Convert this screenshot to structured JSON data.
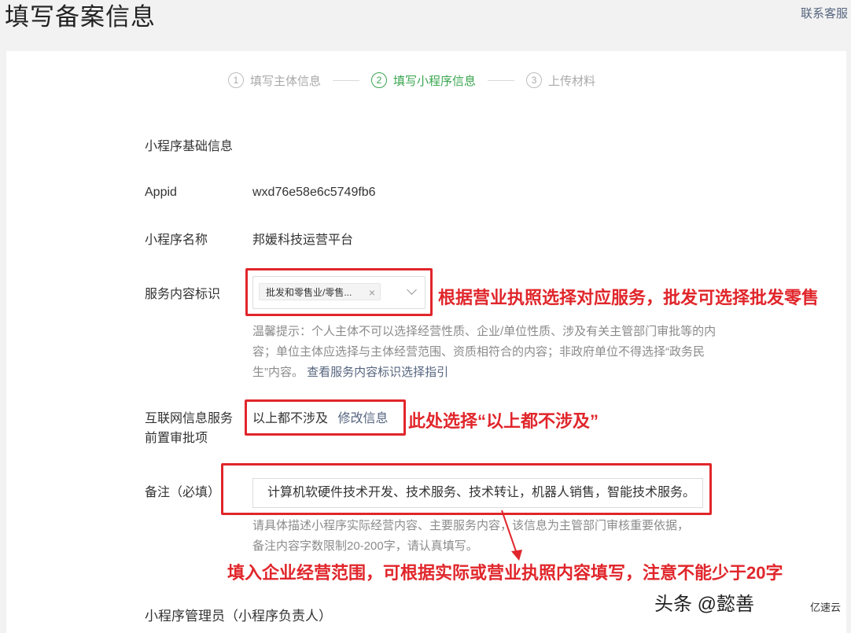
{
  "header": {
    "title": "填写备案信息",
    "service_link": "联系客服"
  },
  "steps": [
    {
      "num": "1",
      "label": "填写主体信息",
      "active": false
    },
    {
      "num": "2",
      "label": "填写小程序信息",
      "active": true
    },
    {
      "num": "3",
      "label": "上传材料",
      "active": false
    }
  ],
  "form": {
    "section_title": "小程序基础信息",
    "appid_label": "Appid",
    "appid_value": "wxd76e58e6c5749fb6",
    "name_label": "小程序名称",
    "name_value": "邦媛科技运营平台",
    "service_label": "服务内容标识",
    "service_tag": "批发和零售业/零售...",
    "service_tag_close": "×",
    "service_tip": "温馨提示：个人主体不可以选择经营性质、企业/单位性质、涉及有关主管部门审批等的内容；单位主体应选择与主体经营范围、资质相符合的内容；非政府单位不得选择“政务民生”内容。",
    "service_guide_link": "查看服务内容标识选择指引",
    "internet_label_1": "互联网信息服务",
    "internet_label_2": "前置审批项",
    "internet_value": "以上都不涉及",
    "internet_modify": "修改信息",
    "remark_label": "备注（必填）",
    "remark_value": "计算机软硬件技术开发、技术服务、技术转让，机器人销售，智能技术服务。",
    "remark_tip_1": "请具体描述小程序实际经营内容、主要服务内容，该信息为主管部门审核重要依据，",
    "remark_tip_2": "备注内容字数限制20-200字，请认真填写。",
    "admin_title": "小程序管理员（小程序负责人）"
  },
  "annotations": {
    "service": "根据营业执照选择对应服务，批发可选择批发零售",
    "internet": "此处选择“以上都不涉及”",
    "remark": "填入企业经营范围，可根据实际或营业执照内容填写，注意不能少于20字"
  },
  "watermark": {
    "text": "头条 @懿善",
    "brand": "亿速云"
  },
  "colors": {
    "accent_green": "#3aa64f",
    "annotation_red": "#e0262b",
    "link_blue": "#56657f"
  }
}
